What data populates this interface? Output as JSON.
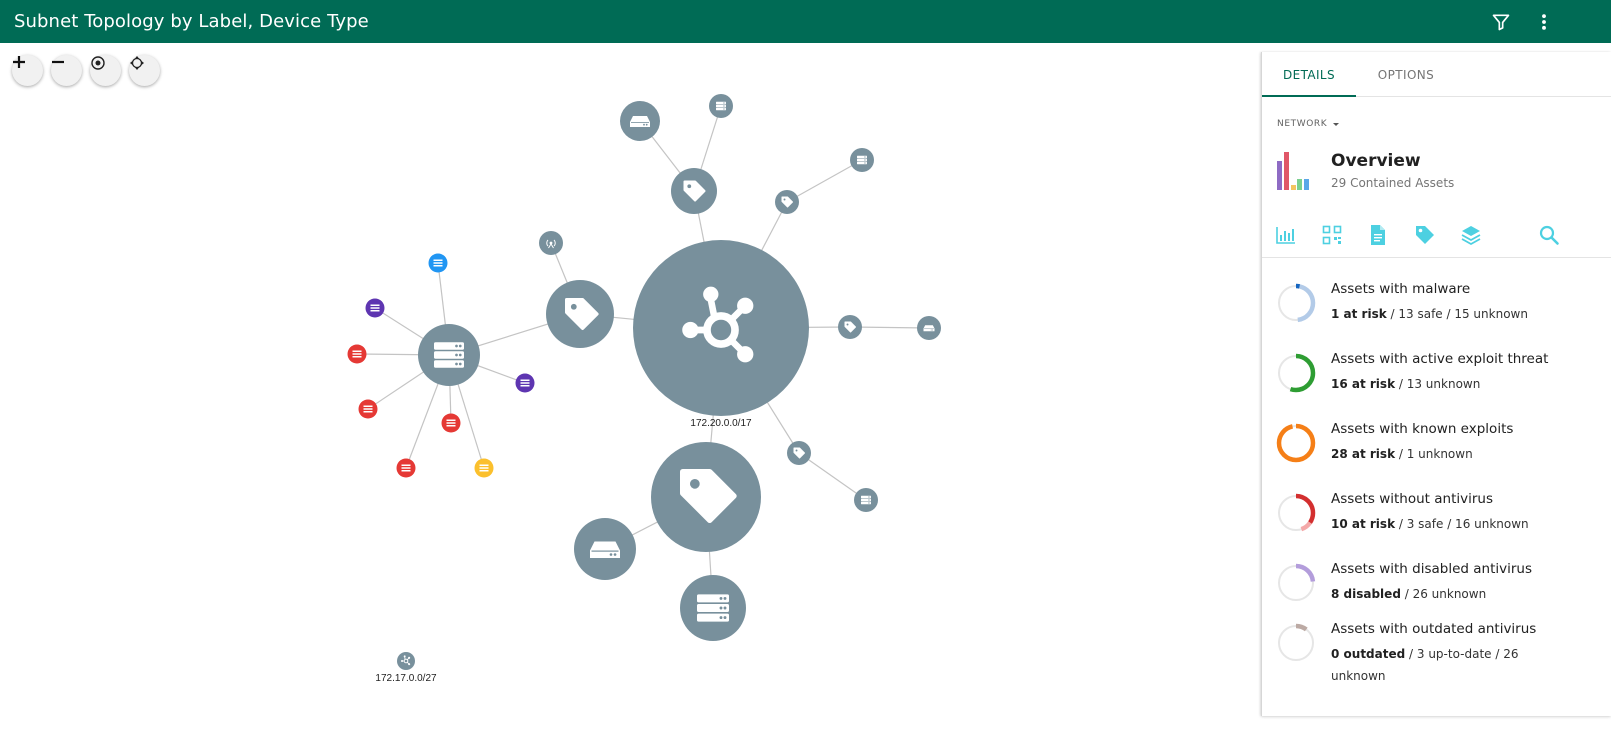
{
  "header": {
    "title": "Subnet Topology by Label, Device Type",
    "filter_icon": "filter-icon",
    "menu_icon": "more-vert-icon"
  },
  "zoom_controls": [
    "zoom-in",
    "zoom-out",
    "center",
    "fit"
  ],
  "graph": {
    "subnet_main_label": "172.20.0.0/17",
    "subnet_small_label": "172.17.0.0/27",
    "node_color": "#78909c",
    "leaf_colors": {
      "blue": "#2196f3",
      "purple": "#5e35b1",
      "red": "#e53935",
      "yellow": "#fbc02d"
    }
  },
  "panel": {
    "tabs": [
      "DETAILS",
      "OPTIONS"
    ],
    "active_tab": "DETAILS",
    "network_selector": "NETWORK",
    "overview_title": "Overview",
    "overview_subtitle": "29 Contained Assets",
    "toolbar_icons": [
      "bar-chart-icon",
      "qr-grid-icon",
      "document-icon",
      "tag-icon",
      "layers-icon",
      "search-icon"
    ],
    "accent": "#4dd0e1",
    "metrics": [
      {
        "title": "Assets with malware",
        "primary": "1 at risk",
        "rest": " / 13 safe / 15 unknown",
        "color": "#1565c0",
        "at_risk": 1,
        "safe": 13,
        "unknown": 15
      },
      {
        "title": "Assets with active exploit threat",
        "primary": "16 at risk",
        "rest": " / 13 unknown",
        "color": "#2e9d33",
        "at_risk": 16,
        "unknown": 13
      },
      {
        "title": "Assets with known exploits",
        "primary": "28 at risk",
        "rest": " / 1 unknown",
        "color": "#f57f17",
        "at_risk": 28,
        "unknown": 1
      },
      {
        "title": "Assets without antivirus",
        "primary": "10 at risk",
        "rest": " / 3 safe / 16 unknown",
        "color": "#d32f2f",
        "at_risk": 10,
        "safe": 3,
        "unknown": 16
      },
      {
        "title": "Assets with disabled antivirus",
        "primary": "8 disabled",
        "rest": " / 26 unknown",
        "color": "#b39ddb",
        "at_risk": 8,
        "unknown": 26
      },
      {
        "title": "Assets with outdated antivirus",
        "primary": "0 outdated",
        "rest": " / 3 up-to-date / 26 unknown",
        "color": "#bcaaa4",
        "at_risk": 0,
        "safe": 3,
        "unknown": 26
      }
    ]
  }
}
